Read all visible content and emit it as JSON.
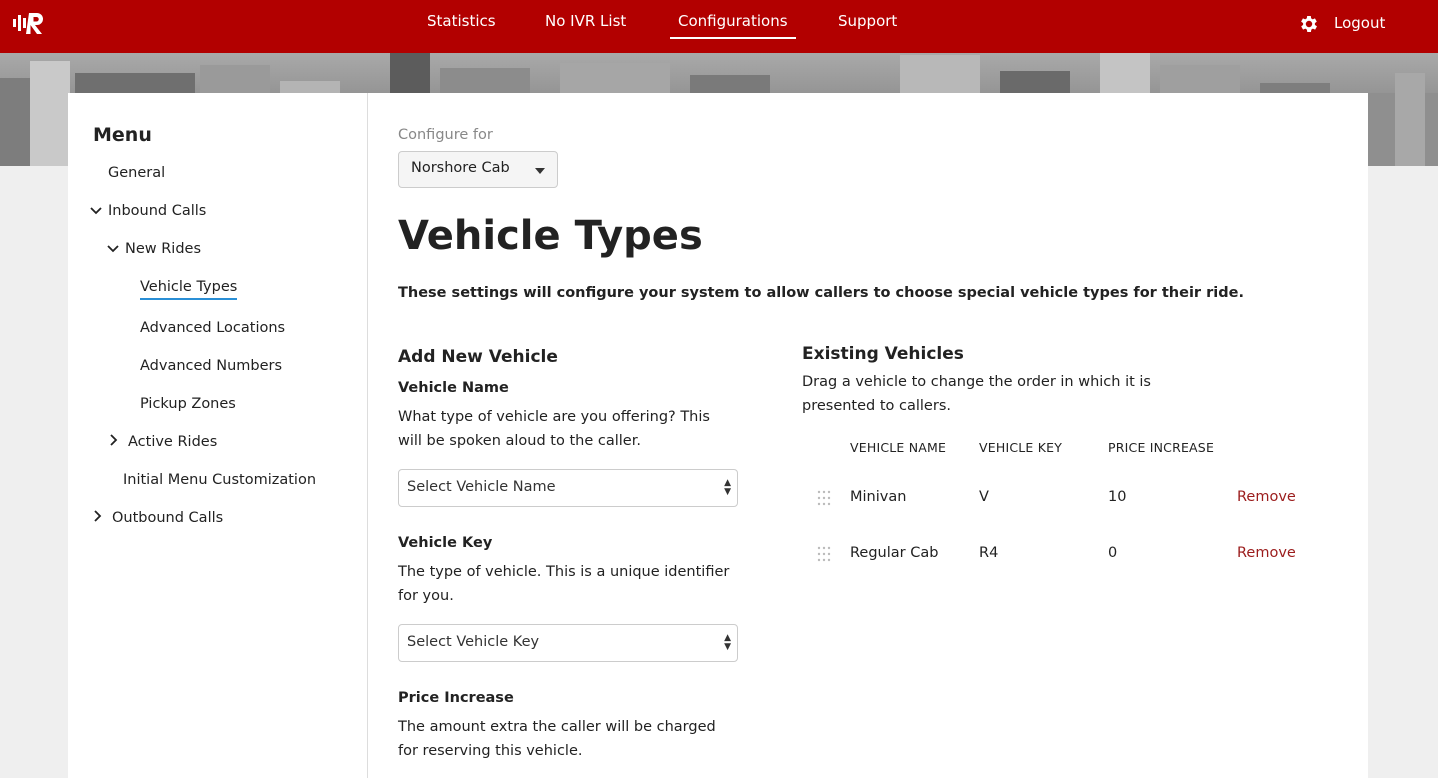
{
  "topnav": {
    "links": [
      {
        "label": "Statistics",
        "active": false
      },
      {
        "label": "No IVR List",
        "active": false
      },
      {
        "label": "Configurations",
        "active": true
      },
      {
        "label": "Support",
        "active": false
      }
    ],
    "logout": "Logout",
    "logo_icon": "ir-logo",
    "settings_icon": "gear-icon",
    "brand_color": "#b20000"
  },
  "sidebar": {
    "title": "Menu",
    "items": [
      {
        "label": "General"
      },
      {
        "label": "Inbound Calls",
        "chevron": "expanded"
      },
      {
        "label": "New Rides",
        "chevron": "expanded"
      },
      {
        "label": "Vehicle Types",
        "active": true
      },
      {
        "label": "Advanced Locations"
      },
      {
        "label": "Advanced Numbers"
      },
      {
        "label": "Pickup Zones"
      },
      {
        "label": "Active Rides",
        "chevron": "collapsed"
      },
      {
        "label": "Initial Menu Customization"
      },
      {
        "label": "Outbound Calls",
        "chevron": "collapsed"
      }
    ],
    "active_color": "#2a8fd6"
  },
  "main": {
    "configure_label": "Configure for",
    "configure_value": "Norshore Cab",
    "title": "Vehicle Types",
    "description": "These settings will configure your system to allow callers to choose special vehicle types for their ride.",
    "add_section": {
      "title": "Add New Vehicle",
      "vehicle_name": {
        "label": "Vehicle Name",
        "help": "What type of vehicle are you offering? This will be spoken aloud to the caller.",
        "placeholder": "Select Vehicle Name"
      },
      "vehicle_key": {
        "label": "Vehicle Key",
        "help": "The type of vehicle. This is a unique identifier for you.",
        "placeholder": "Select Vehicle Key"
      },
      "price_increase": {
        "label": "Price Increase",
        "help": "The amount extra the caller will be charged for reserving this vehicle."
      }
    },
    "existing_section": {
      "title": "Existing Vehicles",
      "help": "Drag a vehicle to change the order in which it is presented to callers.",
      "columns": [
        "VEHICLE NAME",
        "VEHICLE KEY",
        "PRICE INCREASE"
      ],
      "rows": [
        {
          "name": "Minivan",
          "key": "V",
          "price": "10",
          "action": "Remove"
        },
        {
          "name": "Regular Cab",
          "key": "R4",
          "price": "0",
          "action": "Remove"
        }
      ],
      "remove_color": "#9b1c1c"
    }
  }
}
